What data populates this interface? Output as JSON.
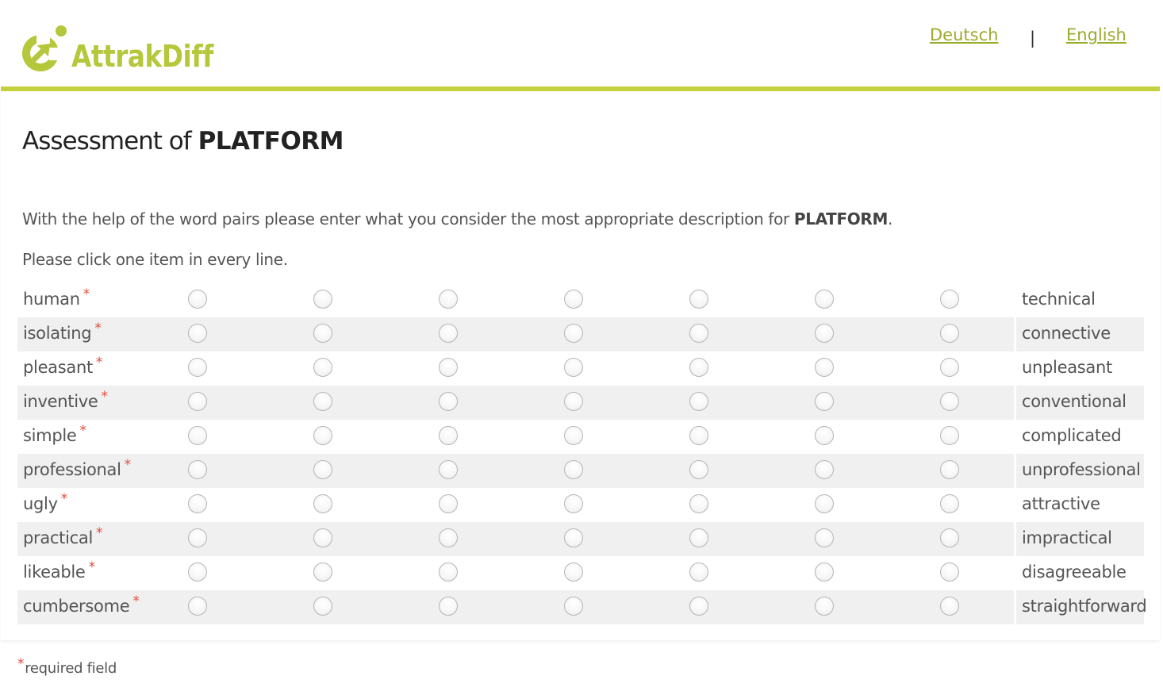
{
  "header": {
    "logo_text": "AttrakDiff",
    "brand_color": "#b5c73a",
    "accent_bar_color": "#c4d13e",
    "languages": [
      {
        "label": "Deutsch"
      },
      {
        "label": "English"
      }
    ],
    "separator": "|"
  },
  "title": {
    "prefix": "Assessment of",
    "product": "PLATFORM"
  },
  "intro": {
    "text_before": "With the help of the word pairs please enter what you consider the most appropriate description for",
    "product": "PLATFORM",
    "text_after": "."
  },
  "instruction": "Please click one item in every line.",
  "required_marker": "*",
  "required_color": "#e24b3b",
  "scale_points": 7,
  "word_pairs": [
    {
      "left": "human",
      "right": "technical"
    },
    {
      "left": "isolating",
      "right": "connective"
    },
    {
      "left": "pleasant",
      "right": "unpleasant"
    },
    {
      "left": "inventive",
      "right": "conventional"
    },
    {
      "left": "simple",
      "right": "complicated"
    },
    {
      "left": "professional",
      "right": "unprofessional"
    },
    {
      "left": "ugly",
      "right": "attractive"
    },
    {
      "left": "practical",
      "right": "impractical"
    },
    {
      "left": "likeable",
      "right": "disagreeable"
    },
    {
      "left": "cumbersome",
      "right": "straightforward"
    }
  ],
  "footer": {
    "required_note": "required field"
  }
}
